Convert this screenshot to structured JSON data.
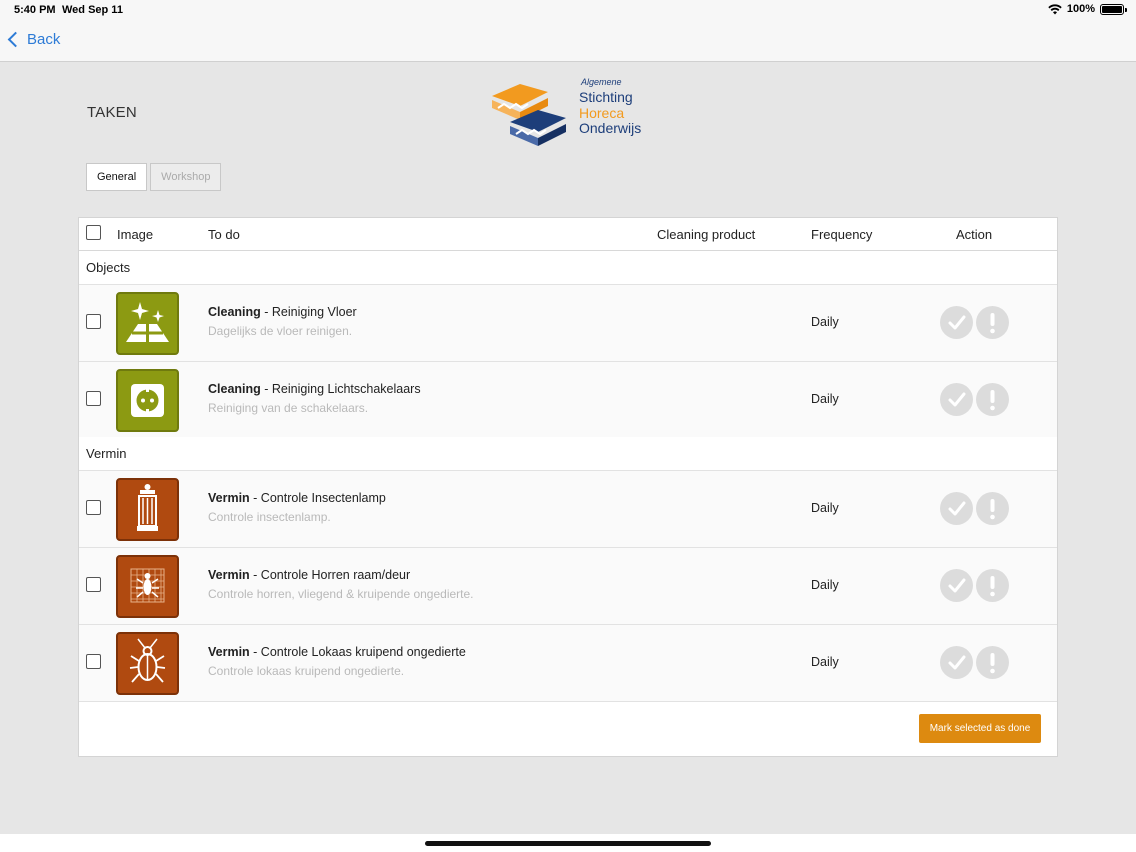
{
  "status_bar": {
    "time": "5:40 PM",
    "date": "Wed Sep 11",
    "battery": "100%"
  },
  "nav": {
    "back_label": "Back"
  },
  "page": {
    "title": "TAKEN"
  },
  "logo": {
    "small": "Algemene",
    "line1": "Stichting",
    "line2": "Horeca",
    "line3": "Onderwijs"
  },
  "tabs": [
    {
      "label": "General",
      "active": true
    },
    {
      "label": "Workshop",
      "active": false
    }
  ],
  "table": {
    "headers": {
      "image": "Image",
      "todo": "To do",
      "product": "Cleaning product",
      "frequency": "Frequency",
      "action": "Action"
    },
    "groups": [
      {
        "name": "Objects",
        "rows": [
          {
            "icon": "floor-cleaning-icon",
            "color": "#8c9a12",
            "category": "Cleaning",
            "title": " - Reiniging Vloer",
            "desc": "Dagelijks de vloer reinigen.",
            "frequency": "Daily"
          },
          {
            "icon": "light-switch-icon",
            "color": "#8c9a12",
            "category": "Cleaning",
            "title": " - Reiniging Lichtschakelaars",
            "desc": "Reiniging van de schakelaars.",
            "frequency": "Daily"
          }
        ]
      },
      {
        "name": "Vermin",
        "rows": [
          {
            "icon": "insect-lamp-icon",
            "color": "#b04a10",
            "category": "Vermin",
            "title": " - Controle Insectenlamp",
            "desc": "Controle insectenlamp.",
            "frequency": "Daily"
          },
          {
            "icon": "window-screen-icon",
            "color": "#b04a10",
            "category": "Vermin",
            "title": " - Controle Horren raam/deur",
            "desc": "Controle horren, vliegend & kruipende ongedierte.",
            "frequency": "Daily"
          },
          {
            "icon": "cockroach-icon",
            "color": "#b04a10",
            "category": "Vermin",
            "title": " - Controle Lokaas kruipend ongedierte",
            "desc": "Controle lokaas kruipend ongedierte.",
            "frequency": "Daily"
          }
        ]
      }
    ]
  },
  "footer": {
    "mark_button": "Mark selected as done"
  }
}
